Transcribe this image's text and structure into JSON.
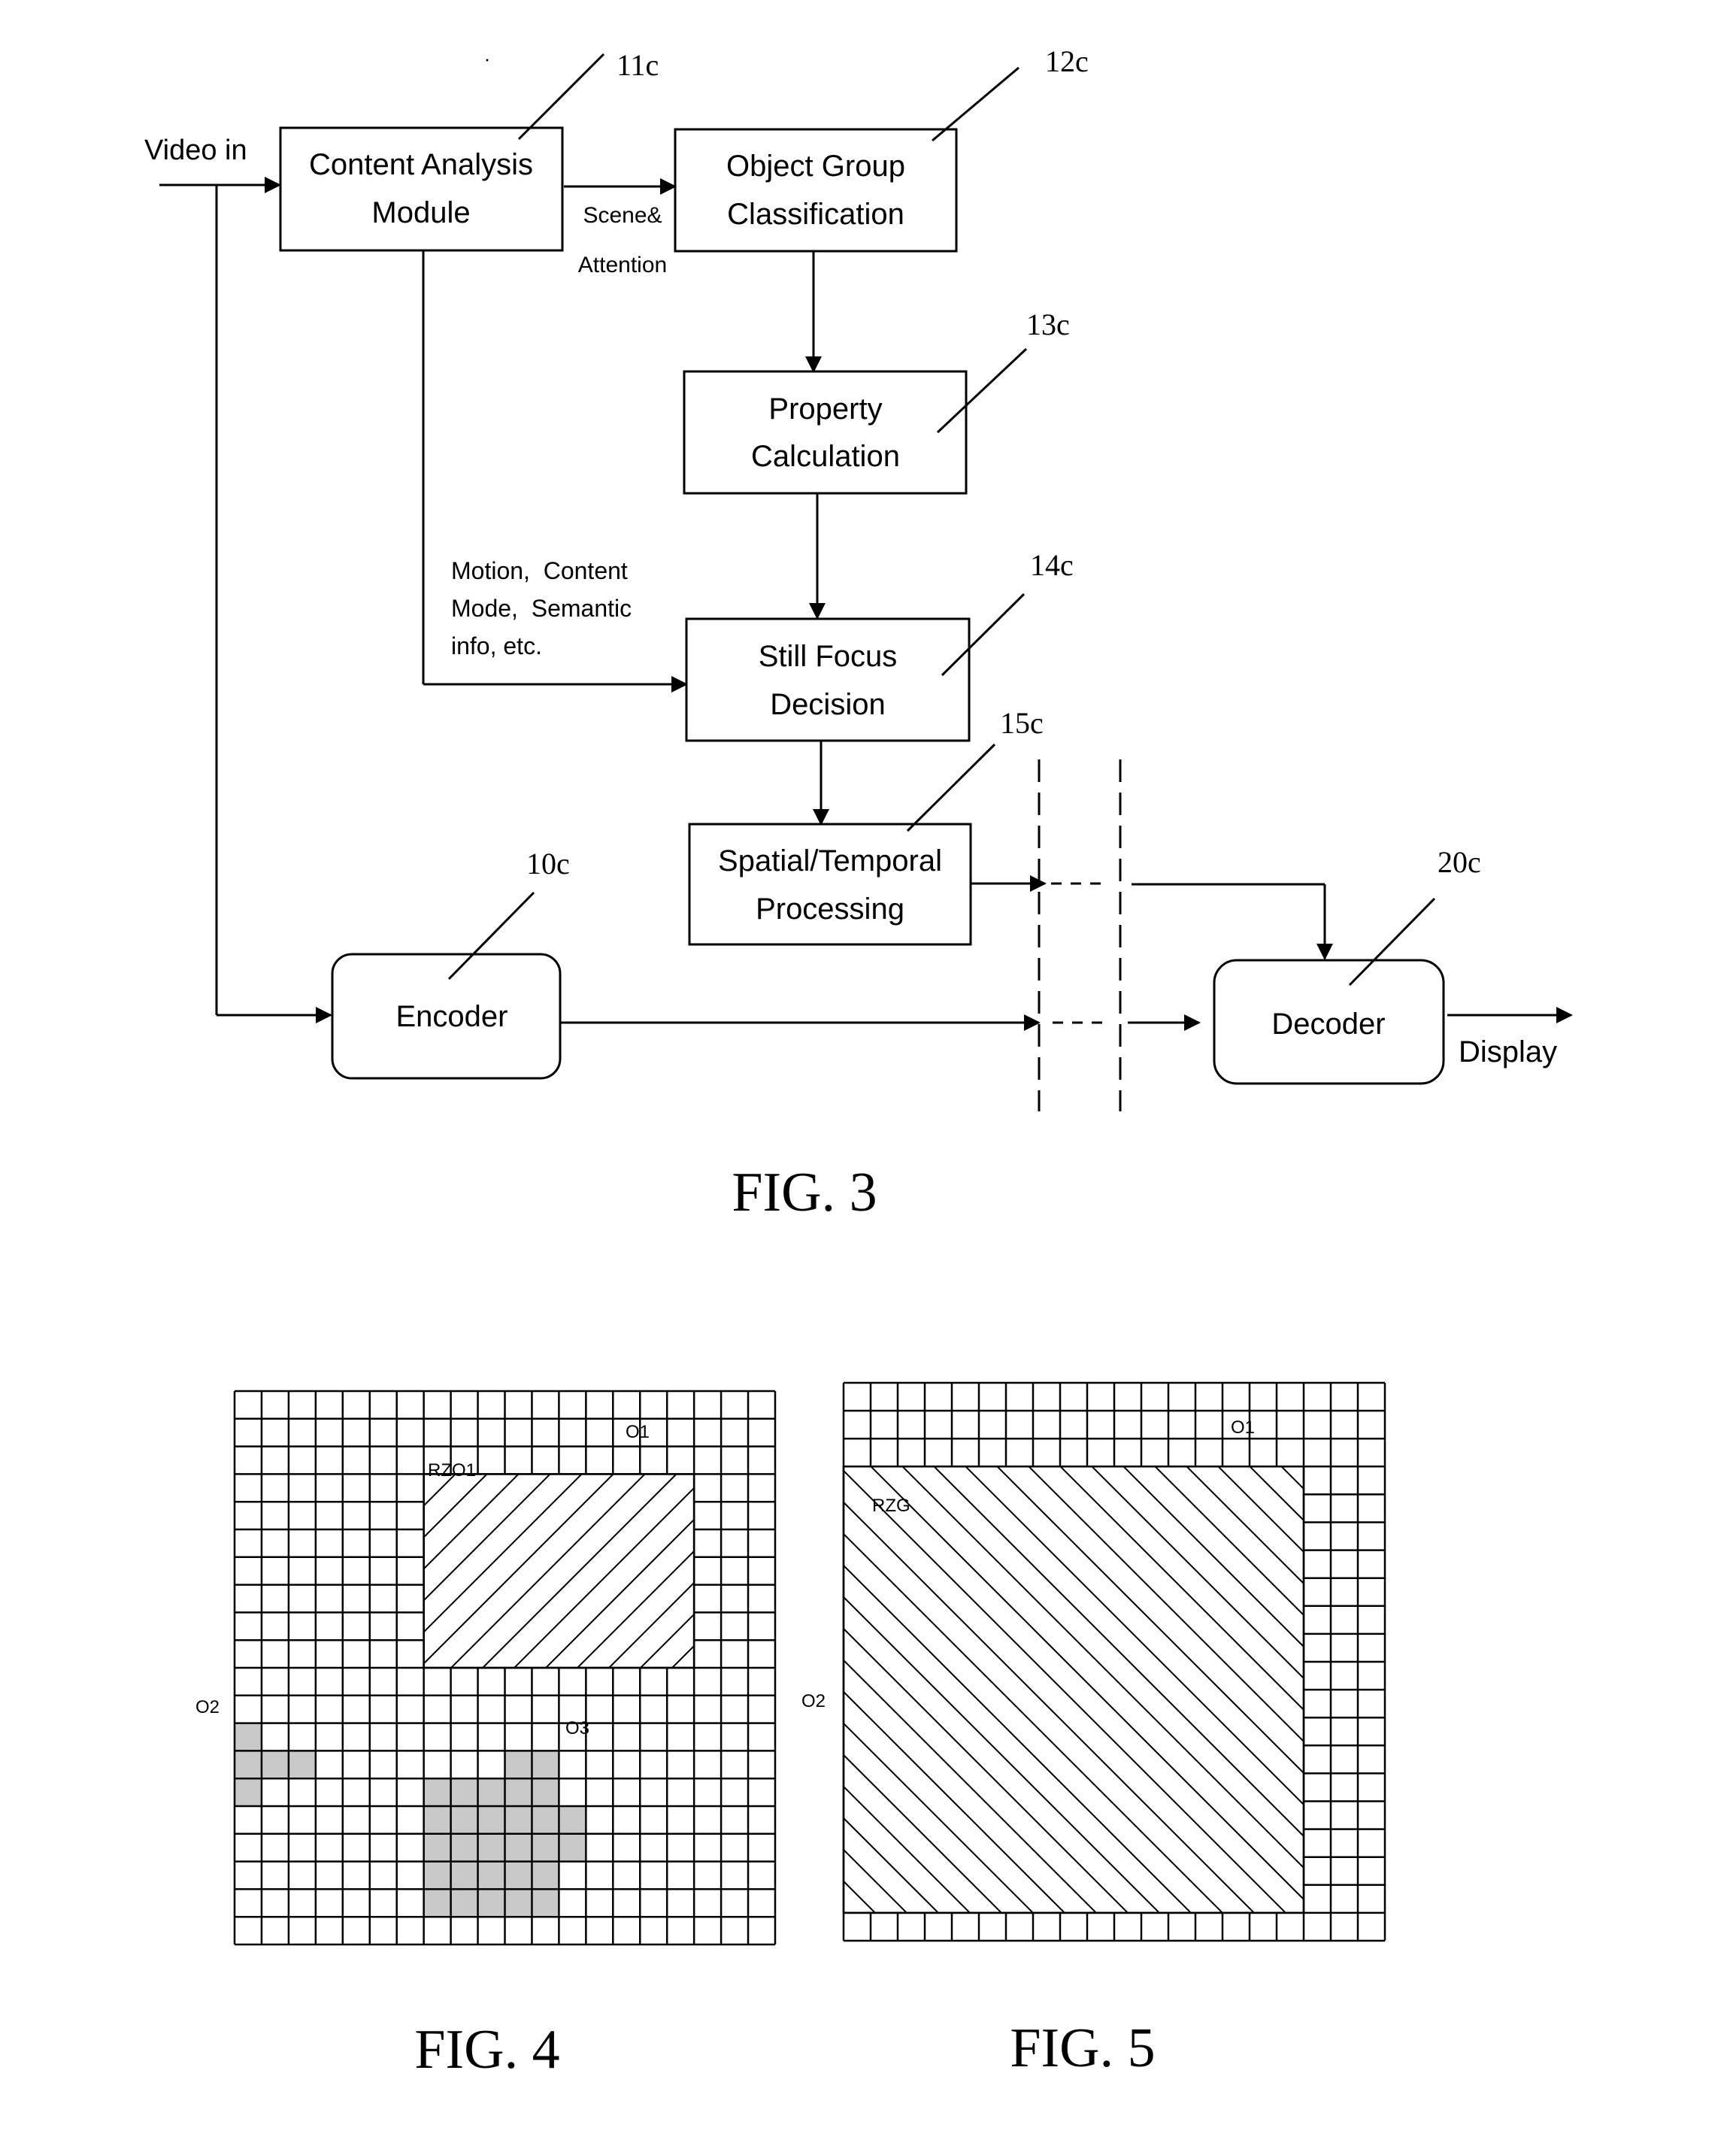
{
  "fig3": {
    "caption": "FIG. 3",
    "input_label": "Video in",
    "output_label": "Display",
    "blocks": {
      "content_analysis": {
        "ref": "11c",
        "lines": [
          "Content Analysis",
          "Module"
        ]
      },
      "object_group": {
        "ref": "12c",
        "lines": [
          "Object Group",
          "Classification"
        ]
      },
      "property_calc": {
        "ref": "13c",
        "lines": [
          "Property",
          "Calculation"
        ]
      },
      "still_focus": {
        "ref": "14c",
        "lines": [
          "Still Focus",
          "Decision"
        ]
      },
      "spatial_temporal": {
        "ref": "15c",
        "lines": [
          "Spatial/Temporal",
          "Processing"
        ]
      },
      "encoder": {
        "ref": "10c",
        "lines": [
          "Encoder"
        ]
      },
      "decoder": {
        "ref": "20c",
        "lines": [
          "Decoder"
        ]
      }
    },
    "edge_labels": {
      "scene_attention": [
        "Scene&",
        "Attention"
      ],
      "motion_info": [
        "Motion,  Content",
        "Mode,  Semantic",
        "info, etc."
      ]
    }
  },
  "fig4": {
    "caption": "FIG. 4",
    "grid": {
      "cols": 20,
      "rows": 20
    },
    "regions": {
      "rzo1": {
        "label": "RZO1",
        "col_start": 7,
        "col_end": 16,
        "row_start": 3,
        "row_end": 9,
        "hatch": "forward"
      }
    },
    "objects": [
      {
        "label": "O1",
        "cells": []
      },
      {
        "label": "O2",
        "cells": [
          [
            0,
            12
          ],
          [
            0,
            13
          ],
          [
            1,
            13
          ],
          [
            2,
            13
          ],
          [
            0,
            14
          ]
        ]
      },
      {
        "label": "O3",
        "cells": [
          [
            10,
            13
          ],
          [
            11,
            13
          ],
          [
            7,
            14
          ],
          [
            8,
            14
          ],
          [
            9,
            14
          ],
          [
            10,
            14
          ],
          [
            11,
            14
          ],
          [
            7,
            15
          ],
          [
            8,
            15
          ],
          [
            9,
            15
          ],
          [
            10,
            15
          ],
          [
            11,
            15
          ],
          [
            12,
            15
          ],
          [
            7,
            16
          ],
          [
            8,
            16
          ],
          [
            9,
            16
          ],
          [
            10,
            16
          ],
          [
            11,
            16
          ],
          [
            12,
            16
          ],
          [
            7,
            17
          ],
          [
            8,
            17
          ],
          [
            9,
            17
          ],
          [
            10,
            17
          ],
          [
            11,
            17
          ],
          [
            7,
            18
          ],
          [
            8,
            18
          ],
          [
            9,
            18
          ],
          [
            10,
            18
          ],
          [
            11,
            18
          ]
        ]
      }
    ]
  },
  "fig5": {
    "caption": "FIG. 5",
    "grid": {
      "cols": 20,
      "rows": 20
    },
    "regions": {
      "rzg": {
        "label": "RZG",
        "col_start": 0,
        "col_end": 16,
        "row_start": 3,
        "row_end": 18,
        "hatch": "back"
      }
    },
    "labels": {
      "o1": "O1",
      "o2": "O2"
    }
  }
}
